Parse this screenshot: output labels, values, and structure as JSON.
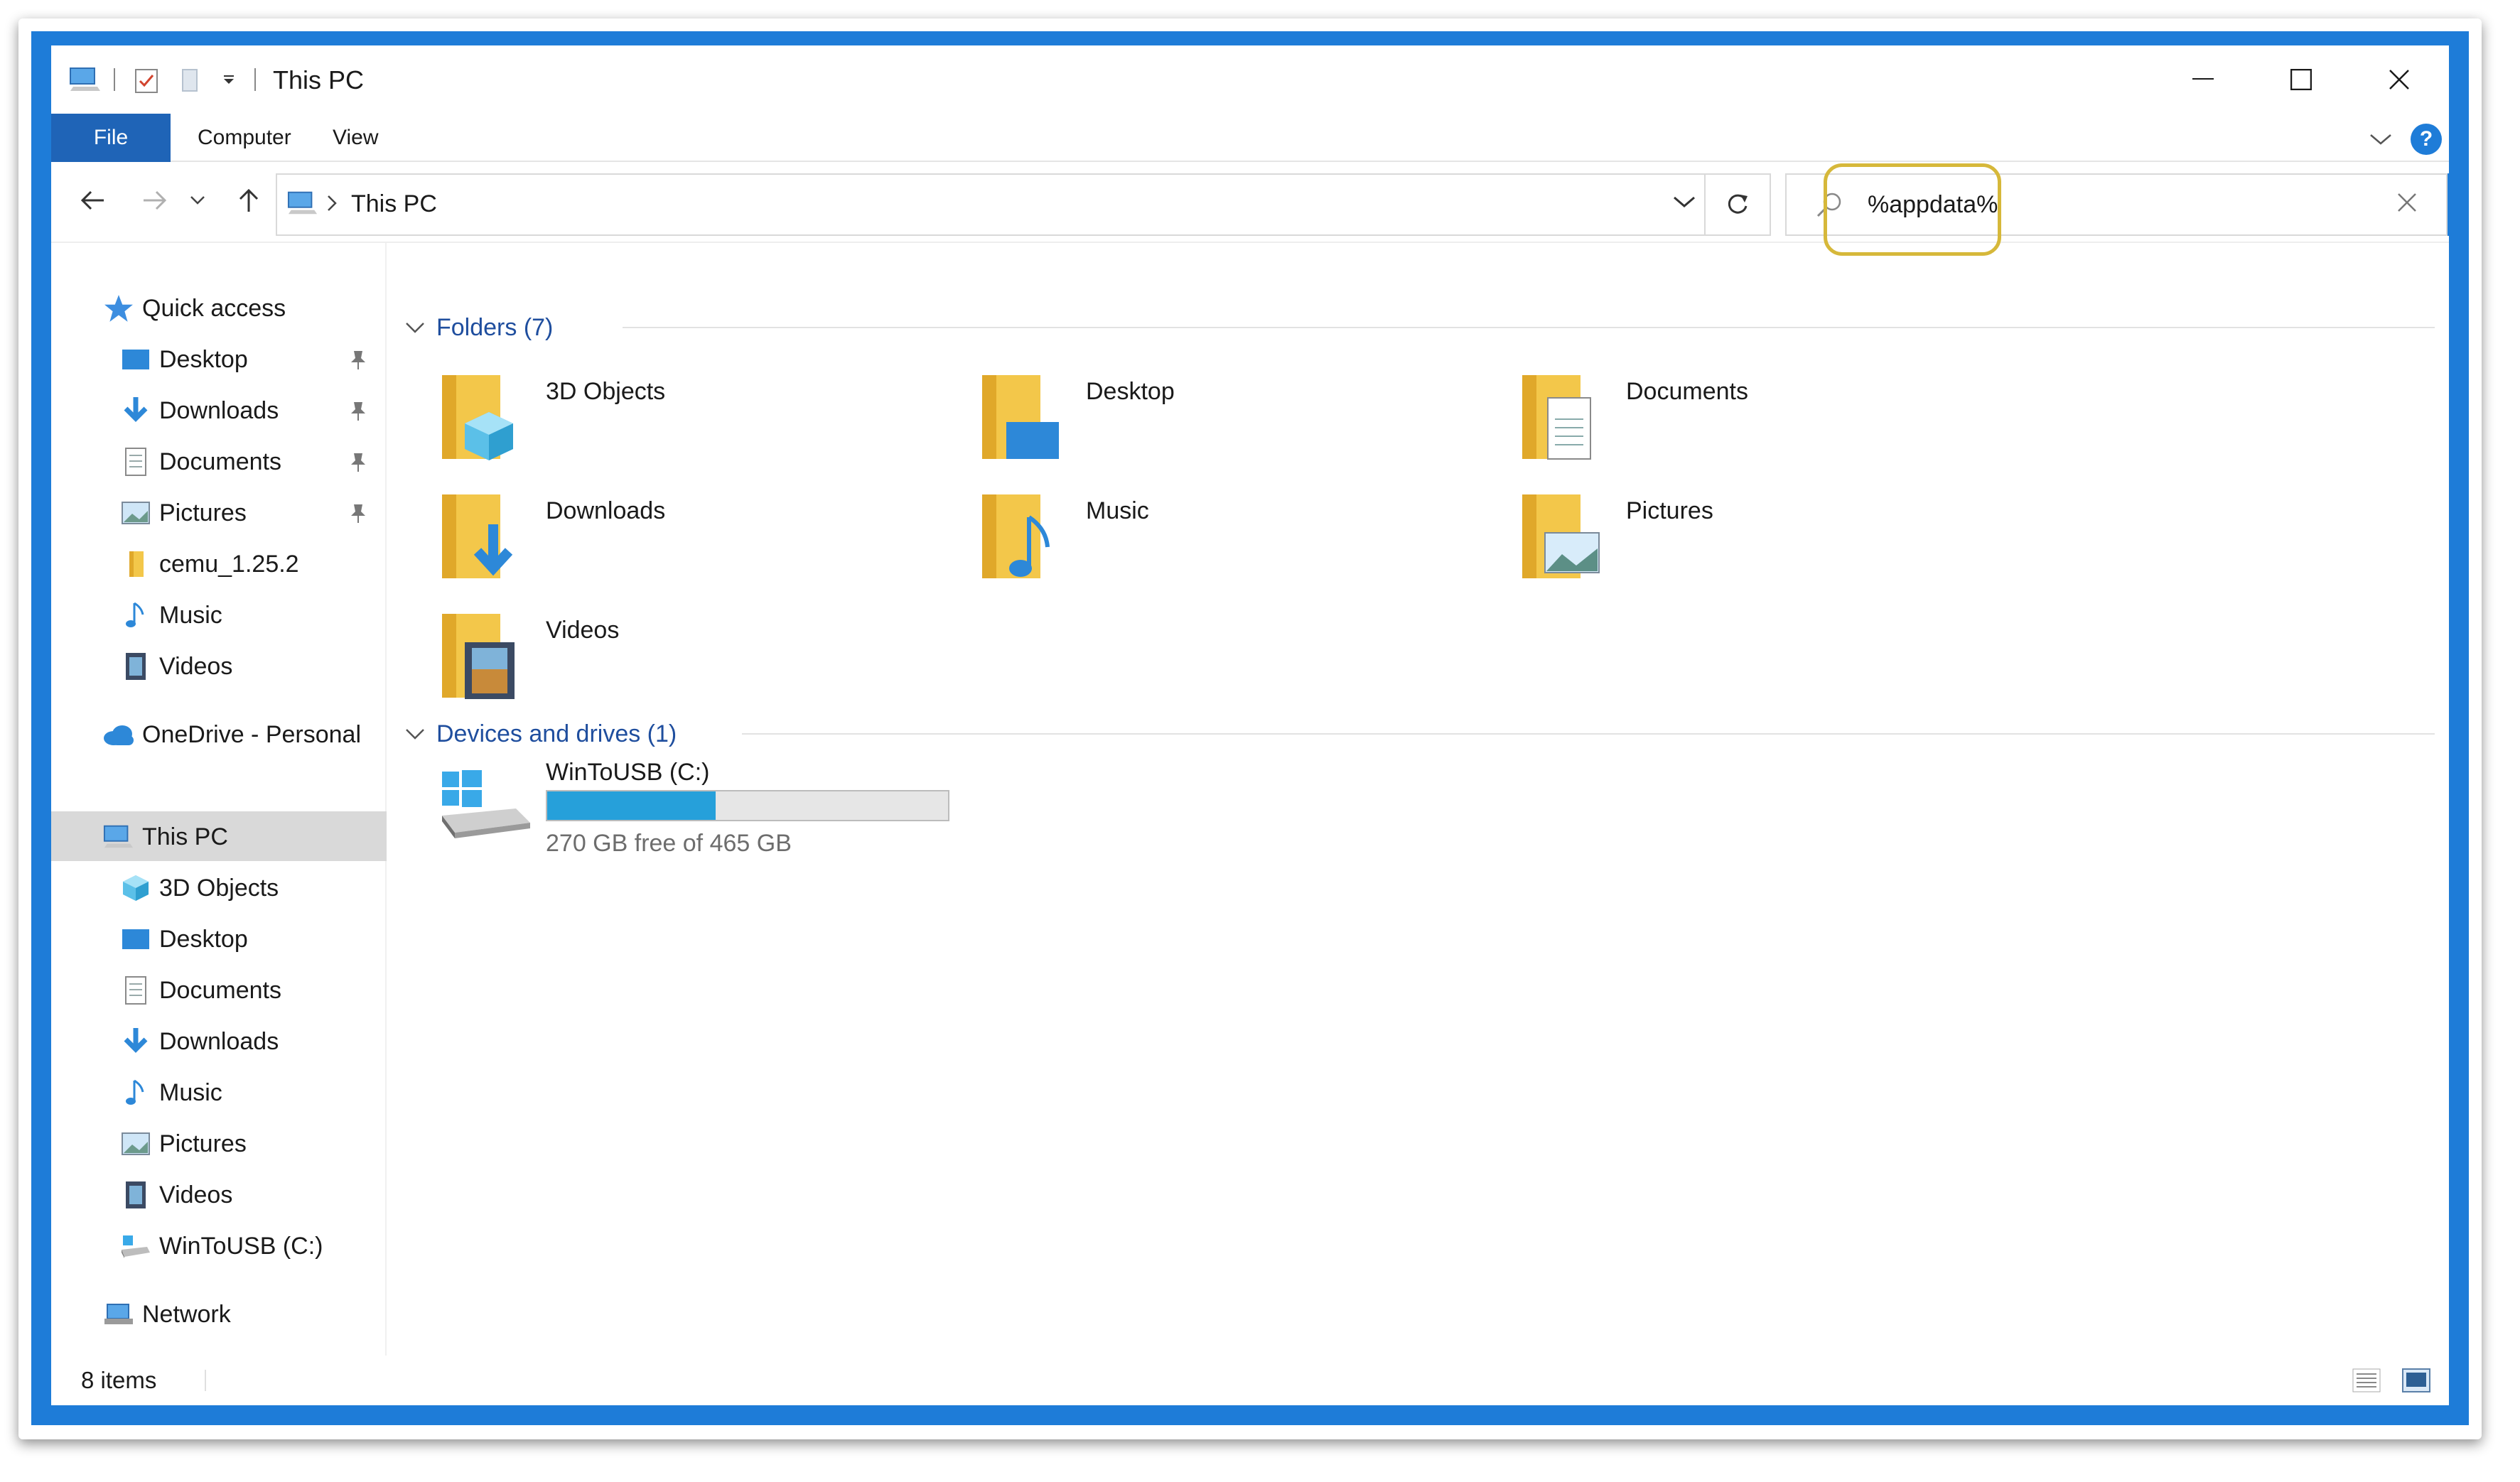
{
  "window": {
    "title": "This PC"
  },
  "ribbon": {
    "tabs": [
      {
        "label": "File"
      },
      {
        "label": "Computer"
      },
      {
        "label": "View"
      }
    ]
  },
  "address": {
    "crumb": "This PC"
  },
  "search": {
    "value": "%appdata%"
  },
  "nav": {
    "quick_access": "Quick access",
    "quick_items": [
      {
        "label": "Desktop",
        "icon": "desktop-icon",
        "pinned": true
      },
      {
        "label": "Downloads",
        "icon": "downloads-icon",
        "pinned": true
      },
      {
        "label": "Documents",
        "icon": "documents-icon",
        "pinned": true
      },
      {
        "label": "Pictures",
        "icon": "pictures-icon",
        "pinned": true
      },
      {
        "label": "cemu_1.25.2",
        "icon": "folder-icon",
        "pinned": false
      },
      {
        "label": "Music",
        "icon": "music-icon",
        "pinned": false
      },
      {
        "label": "Videos",
        "icon": "videos-icon",
        "pinned": false
      }
    ],
    "onedrive": "OneDrive - Personal",
    "this_pc": "This PC",
    "pc_items": [
      {
        "label": "3D Objects",
        "icon": "3d-objects-icon"
      },
      {
        "label": "Desktop",
        "icon": "desktop-icon"
      },
      {
        "label": "Documents",
        "icon": "documents-icon"
      },
      {
        "label": "Downloads",
        "icon": "downloads-icon"
      },
      {
        "label": "Music",
        "icon": "music-icon"
      },
      {
        "label": "Pictures",
        "icon": "pictures-icon"
      },
      {
        "label": "Videos",
        "icon": "videos-icon"
      },
      {
        "label": "WinToUSB (C:)",
        "icon": "drive-icon"
      }
    ],
    "network": "Network"
  },
  "content": {
    "folders_header": "Folders (7)",
    "folders": [
      {
        "label": "3D Objects",
        "icon": "3d-objects-folder-icon"
      },
      {
        "label": "Desktop",
        "icon": "desktop-folder-icon"
      },
      {
        "label": "Documents",
        "icon": "documents-folder-icon"
      },
      {
        "label": "Downloads",
        "icon": "downloads-folder-icon"
      },
      {
        "label": "Music",
        "icon": "music-folder-icon"
      },
      {
        "label": "Pictures",
        "icon": "pictures-folder-icon"
      },
      {
        "label": "Videos",
        "icon": "videos-folder-icon"
      }
    ],
    "devices_header": "Devices and drives (1)",
    "drive": {
      "name": "WinToUSB (C:)",
      "free_text": "270 GB free of 465 GB",
      "used_fraction": 0.42
    }
  },
  "status": {
    "count": "8 items"
  },
  "colors": {
    "accent": "#1e7cd8",
    "file_tab": "#1f64b7",
    "highlight": "#d6b83a",
    "drive_bar": "#26a0da",
    "group_header": "#1f4e9e",
    "folder_yellow": "#f3c74a"
  }
}
